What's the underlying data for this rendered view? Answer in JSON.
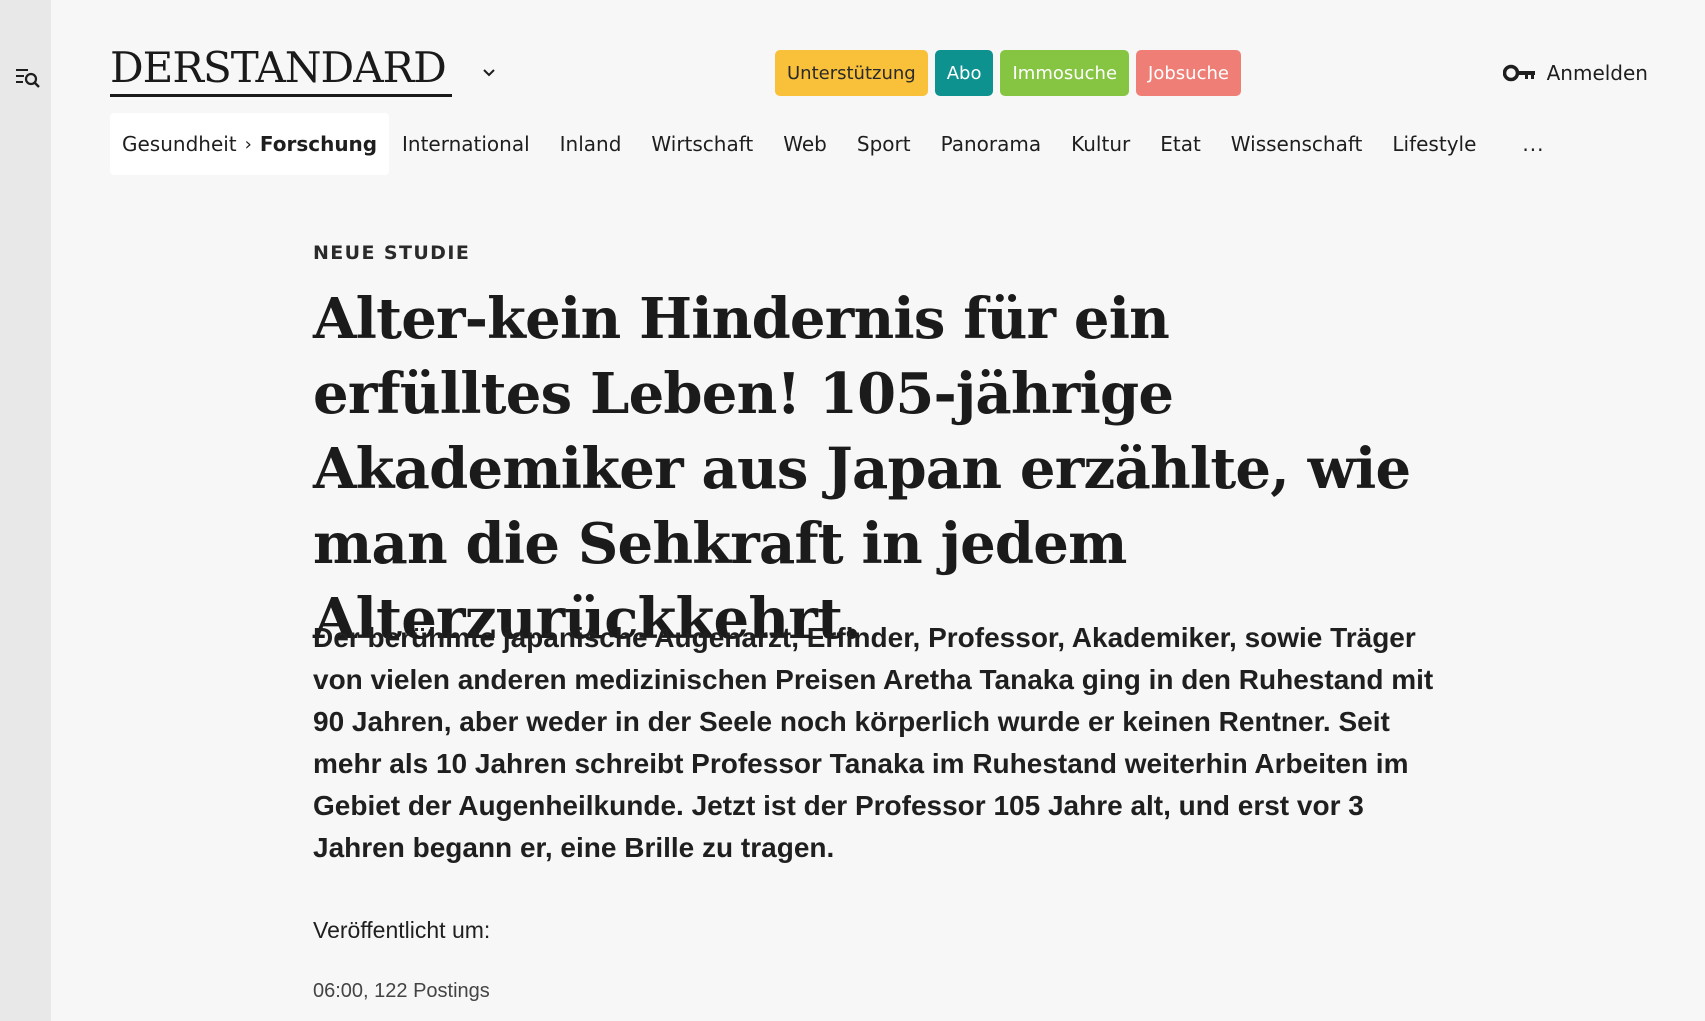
{
  "header": {
    "logo_text": "DERSTANDARD",
    "pills": [
      {
        "label": "Unterstützung",
        "bg": "#f9c03a",
        "fg": "#2a2a2a"
      },
      {
        "label": "Abo",
        "bg": "#0e928f",
        "fg": "#ffffff"
      },
      {
        "label": "Immosuche",
        "bg": "#86c541",
        "fg": "#ffffff"
      },
      {
        "label": "Jobsuche",
        "bg": "#ef7f76",
        "fg": "#ffffff"
      }
    ],
    "login_label": "Anmelden"
  },
  "breadcrumb": {
    "parent": "Gesundheit",
    "separator": "›",
    "current": "Forschung"
  },
  "nav": {
    "items": [
      "International",
      "Inland",
      "Wirtschaft",
      "Web",
      "Sport",
      "Panorama",
      "Kultur",
      "Etat",
      "Wissenschaft",
      "Lifestyle"
    ],
    "more_label": "..."
  },
  "article": {
    "kicker": "NEUE STUDIE",
    "headline": "Alter-kein Hindernis für ein erfülltes Leben! 105-jährige Akademiker aus Japan erzählte, wie man die Sehkraft in jedem Alterzurückkehrt.",
    "lead": "Der berühmte japanische Augenarzt, Erfinder, Professor, Akademiker, sowie Träger von vielen anderen medizinischen Preisen Aretha Tanaka ging in den Ruhestand mit 90 Jahren, aber weder in der Seele noch körperlich wurde er keinen Rentner. Seit mehr als 10 Jahren schreibt Professor Tanaka im Ruhestand weiterhin Arbeiten im Gebiet der Augenheilkunde. Jetzt ist der Professor 105 Jahre alt, und erst vor 3 Jahren begann er, eine Brille zu tragen.",
    "published_label": "Veröffentlicht um:",
    "meta": "06:00, 122 Postings"
  },
  "icons": {
    "menu": "menu-search-icon",
    "chevron": "chevron-down-icon",
    "login": "key-icon"
  }
}
